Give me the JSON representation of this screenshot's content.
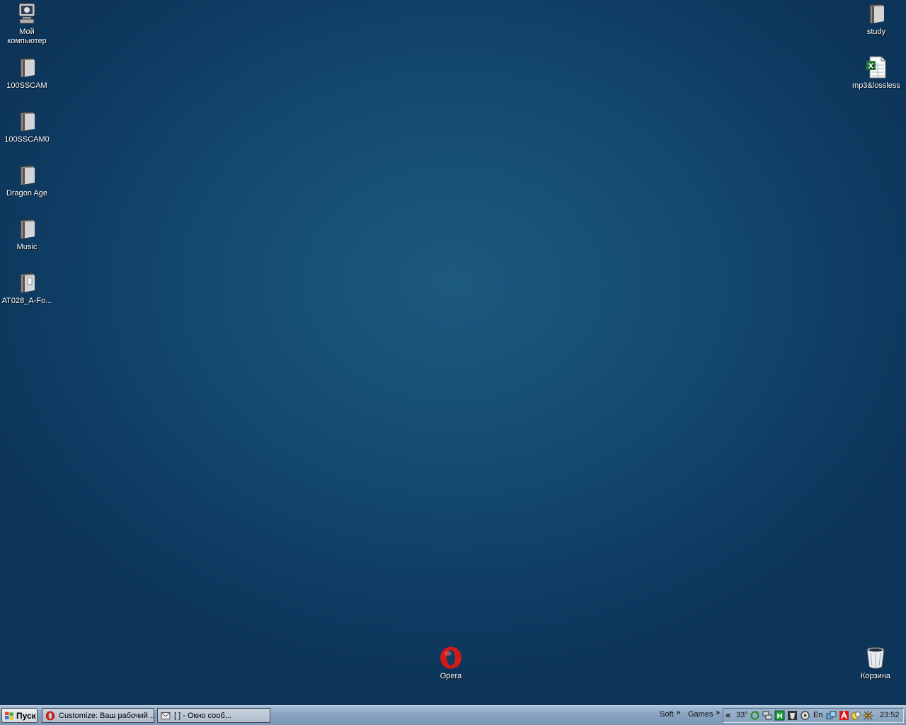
{
  "desktop": {
    "icons_left": [
      {
        "label": "Мой компьютер",
        "icon": "my-computer-icon"
      },
      {
        "label": "100SSCAM",
        "icon": "folder-icon"
      },
      {
        "label": "100SSCAM0",
        "icon": "folder-icon"
      },
      {
        "label": "Dragon Age",
        "icon": "folder-icon"
      },
      {
        "label": "Music",
        "icon": "folder-icon"
      },
      {
        "label": "AT028_A-Fo...",
        "icon": "folder-icon"
      }
    ],
    "icons_right": [
      {
        "label": "study",
        "icon": "folder-icon"
      },
      {
        "label": "mp3&lossless",
        "icon": "excel-file-icon"
      }
    ],
    "opera": {
      "label": "Opera",
      "icon": "opera-icon"
    },
    "recycle_bin": {
      "label": "Корзина",
      "icon": "recycle-bin-icon"
    }
  },
  "taskbar": {
    "start_label": "Пуск",
    "tasks": [
      {
        "label": "Customize: Ваш рабочий ...",
        "icon": "opera-icon"
      },
      {
        "label": "[                 ] - Окно сооб...",
        "icon": "message-icon"
      }
    ],
    "quick_links": [
      {
        "label": "Soft"
      },
      {
        "label": "Games"
      }
    ],
    "tray": {
      "expand_label": "«",
      "temperature": "33°",
      "language": "En",
      "clock": "23:52"
    }
  },
  "colors": {
    "desktop_center": "#1c5a7e",
    "desktop_edge": "#0d355a",
    "taskbar": "#8aa5c2"
  }
}
